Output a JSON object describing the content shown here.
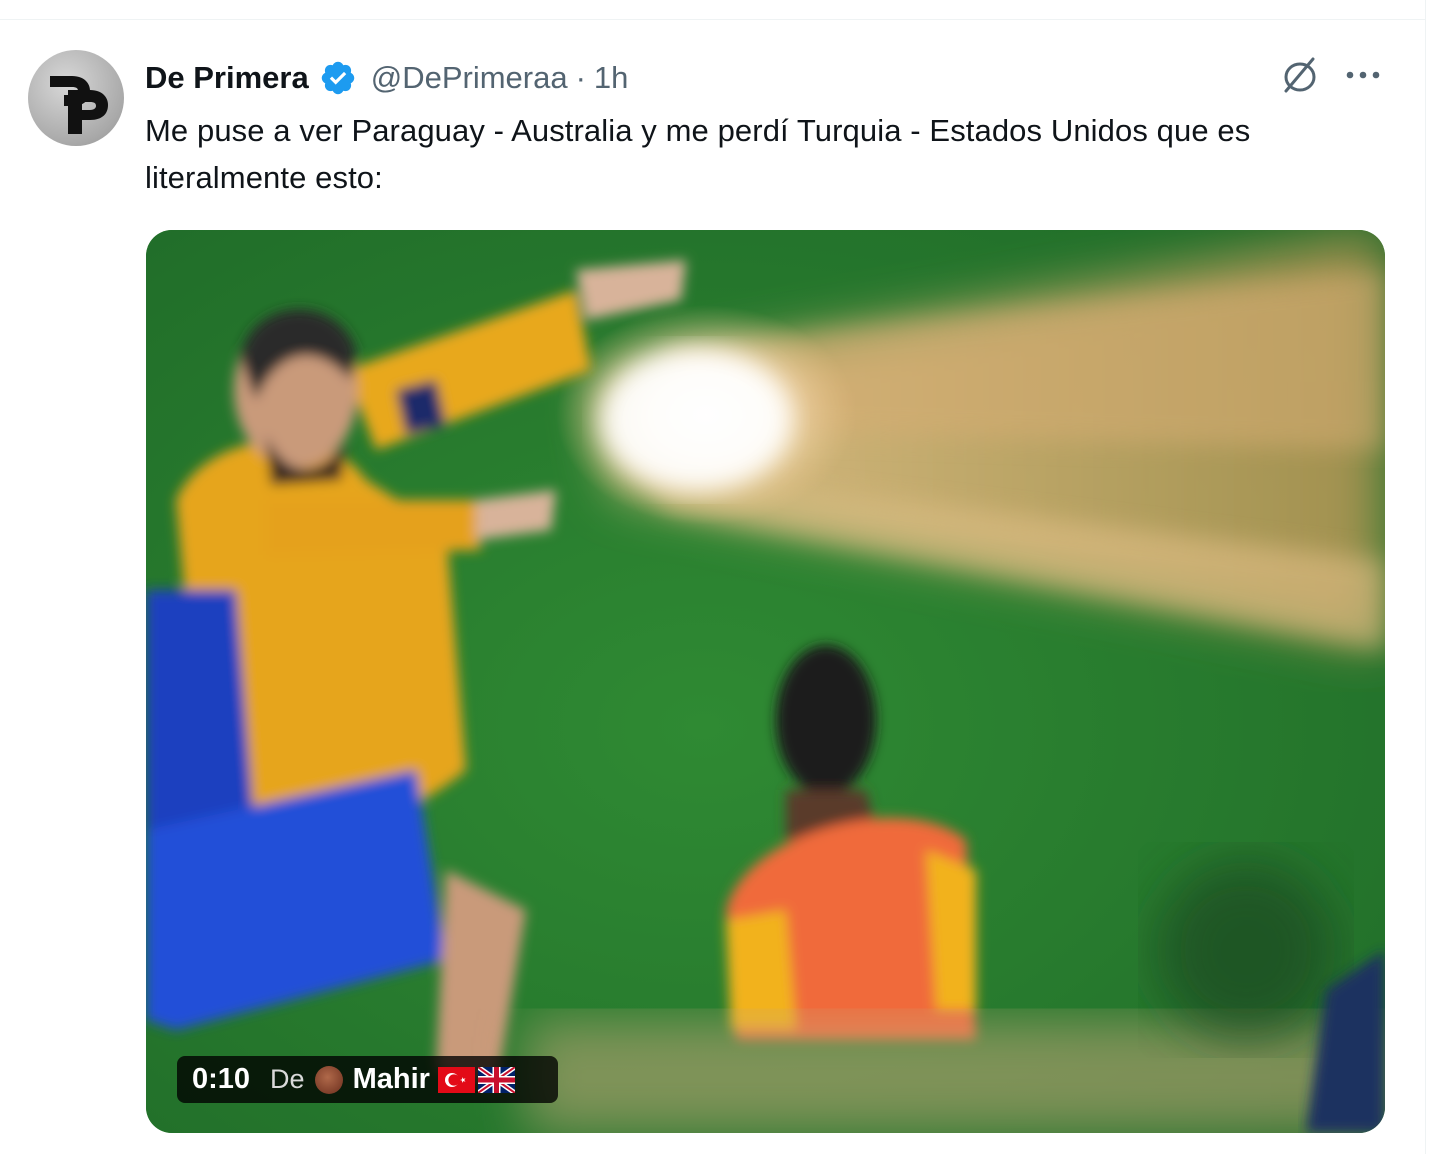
{
  "tweet": {
    "author": {
      "display_name": "De Primera",
      "handle": "@DePrimeraa",
      "verified": true,
      "avatar_icon": "dp-logo-avatar"
    },
    "separator": "·",
    "time": "1h",
    "text": "Me puse a ver Paraguay - Australia y me perdí Turquia - Estados Unidos que es literalmente esto:",
    "actions": {
      "grok_icon": "grok-icon",
      "more_icon": "more-icon"
    },
    "media": {
      "type": "video",
      "timestamp": "0:10",
      "from_label": "De",
      "source_name": "Mahir",
      "flags": [
        "turkey-flag",
        "uk-flag"
      ]
    }
  },
  "colors": {
    "text_primary": "#0f1419",
    "text_secondary": "#536471",
    "verified_blue": "#1d9bf0",
    "divider": "#eff3f4"
  }
}
